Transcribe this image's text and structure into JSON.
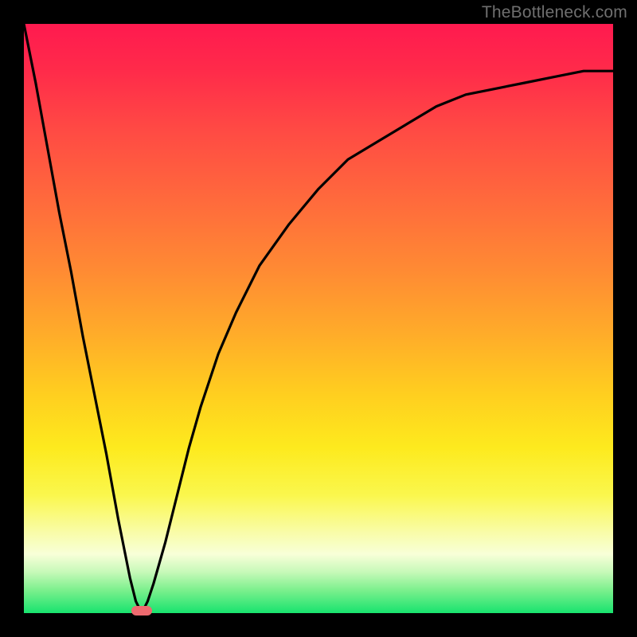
{
  "watermark": {
    "text": "TheBottleneck.com"
  },
  "colors": {
    "frame": "#000000",
    "gradient_stops": [
      "#ff1a4f",
      "#ff2b4a",
      "#ff4a44",
      "#ff6a3c",
      "#ff8b33",
      "#ffad29",
      "#ffcf1f",
      "#fdea1e",
      "#faf74d",
      "#f9fca4",
      "#f8ffd8",
      "#c7f9b9",
      "#7ef08e",
      "#18e36e"
    ],
    "curve": "#000000",
    "floor_mark": "#ed6a6f"
  },
  "chart_data": {
    "type": "line",
    "title": "",
    "xlabel": "",
    "ylabel": "",
    "xlim": [
      0,
      100
    ],
    "ylim": [
      0,
      100
    ],
    "grid": false,
    "legend": false,
    "series": [
      {
        "name": "curve",
        "x": [
          0,
          2,
          4,
          6,
          8,
          10,
          12,
          14,
          16,
          18,
          19,
          20,
          21,
          22,
          24,
          26,
          28,
          30,
          33,
          36,
          40,
          45,
          50,
          55,
          60,
          65,
          70,
          75,
          80,
          85,
          90,
          95,
          100
        ],
        "y": [
          100,
          90,
          79,
          68,
          58,
          47,
          37,
          27,
          16,
          6,
          2,
          0,
          2,
          5,
          12,
          20,
          28,
          35,
          44,
          51,
          59,
          66,
          72,
          77,
          80,
          83,
          86,
          88,
          89,
          90,
          91,
          92,
          92
        ]
      }
    ],
    "annotations": [
      {
        "name": "floor-mark",
        "x": 20,
        "y": 0,
        "shape": "pill",
        "color": "#ed6a6f"
      }
    ],
    "notes": "Values read from pixel geometry of a 740×740 plot area; precision implied by the chart is whole-number percentages."
  }
}
